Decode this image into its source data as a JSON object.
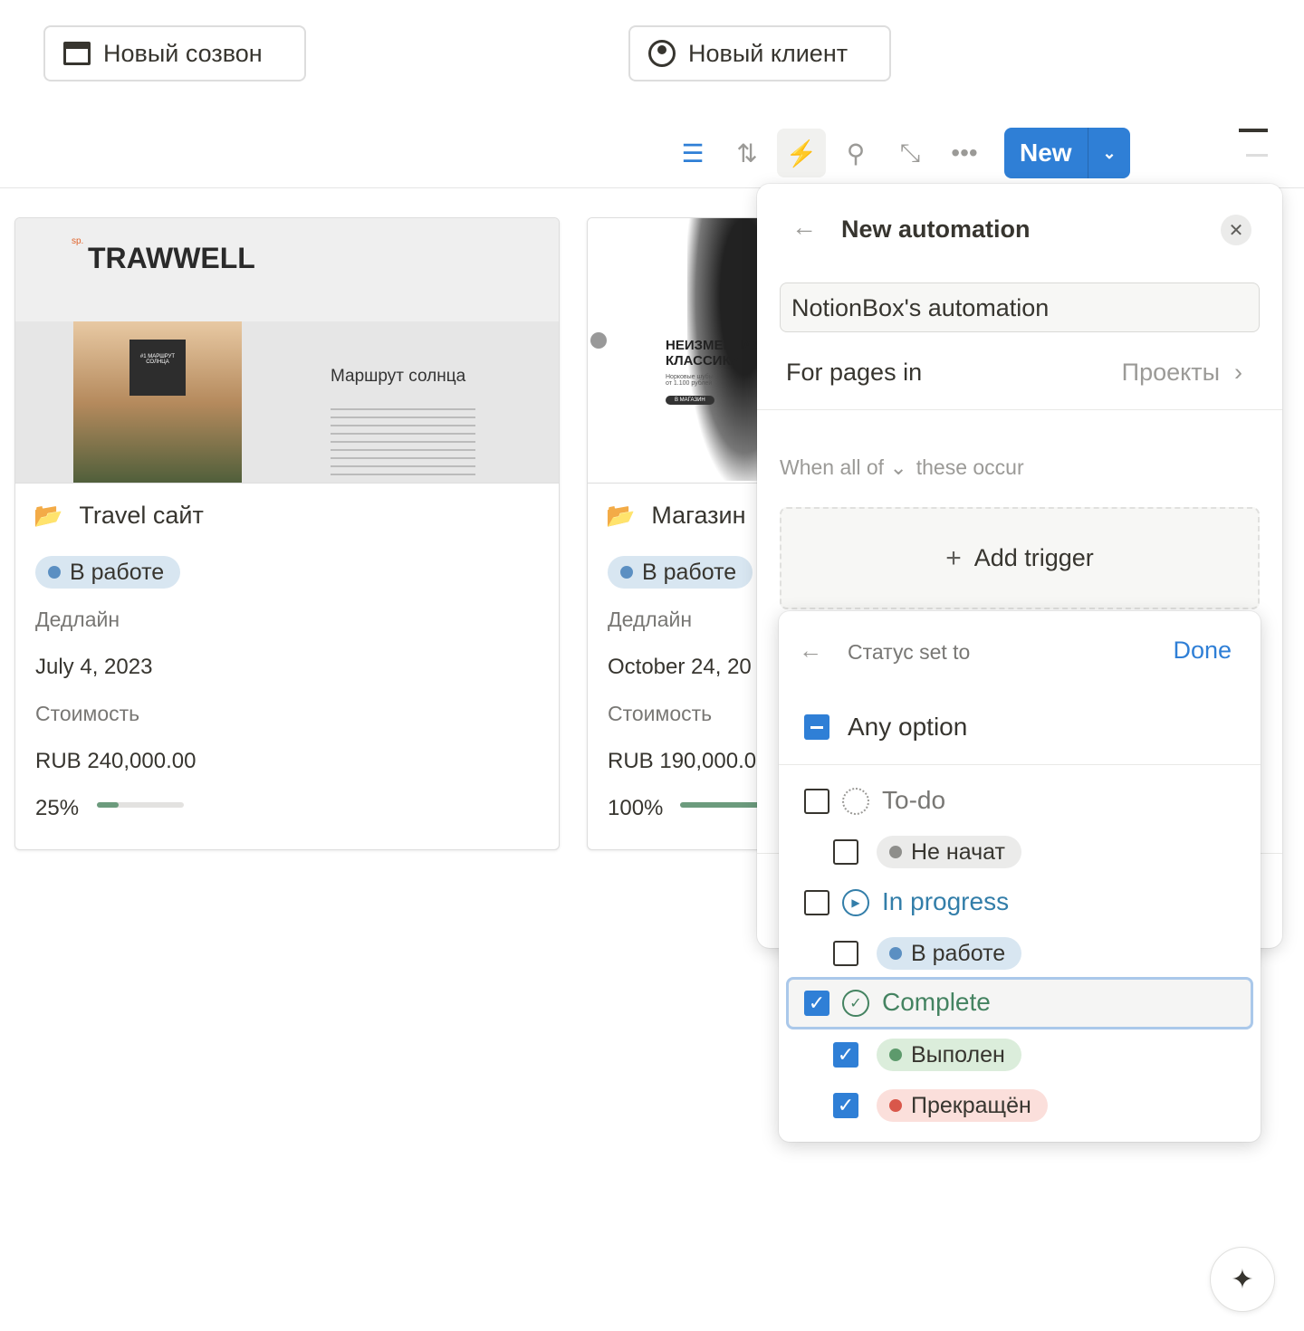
{
  "top_buttons": {
    "new_call": "Новый созвон",
    "new_client": "Новый клиент"
  },
  "toolbar": {
    "new_label": "New",
    "icons": [
      "filter-icon",
      "sort-icon",
      "lightning-icon",
      "search-icon",
      "expand-icon",
      "more-icon"
    ],
    "accent": "#2f7fd6"
  },
  "cards": [
    {
      "title": "Travel сайт",
      "status": "В работе",
      "deadline_label": "Дедлайн",
      "deadline": "July 4, 2023",
      "cost_label": "Стоимость",
      "cost": "RUB 240,000.00",
      "progress_text": "25%",
      "progress": 0.25,
      "thumb": {
        "logo": "TRAWWELL",
        "logo_prefix": "sp.",
        "heading": "Маршрут солнца",
        "badge": "#1 МАРШРУТ СОЛНЦА"
      }
    },
    {
      "title": "Магазин",
      "status": "В работе",
      "deadline_label": "Дедлайн",
      "deadline": "October 24, 20",
      "cost_label": "Стоимость",
      "cost": "RUB 190,000.0",
      "progress_text": "100%",
      "progress": 1.0,
      "thumb": {
        "heading": "НЕИЗМЕННАЯ КЛАССИКА",
        "sub": "Норковые шубы от 1.100 рублей",
        "button": "В МАГАЗИН"
      }
    }
  ],
  "automation": {
    "title": "New automation",
    "name_value": "NotionBox's automation",
    "for_pages_label": "For pages in",
    "for_pages_value": "Проекты",
    "when_prefix": "When all of",
    "when_suffix": "these occur",
    "add_trigger": "Add trigger"
  },
  "status_popup": {
    "title": "Статус set to",
    "done": "Done",
    "any_option": "Any option",
    "groups": [
      {
        "label": "To-do",
        "checked": false,
        "color": "#787774",
        "options": [
          {
            "label": "Не начат",
            "checked": false,
            "bg": "#ebebea",
            "dot": "#8e8e8b"
          }
        ]
      },
      {
        "label": "In progress",
        "checked": false,
        "color": "#337ea9",
        "options": [
          {
            "label": "В работе",
            "checked": false,
            "bg": "#d8e6f1",
            "dot": "#5b8fc2"
          }
        ]
      },
      {
        "label": "Complete",
        "checked": true,
        "color": "#448361",
        "options": [
          {
            "label": "Выполен",
            "checked": true,
            "bg": "#dbeddb",
            "dot": "#5d9a6c"
          },
          {
            "label": "Прекращён",
            "checked": true,
            "bg": "#fbdfdb",
            "dot": "#d9574a"
          }
        ]
      }
    ]
  }
}
